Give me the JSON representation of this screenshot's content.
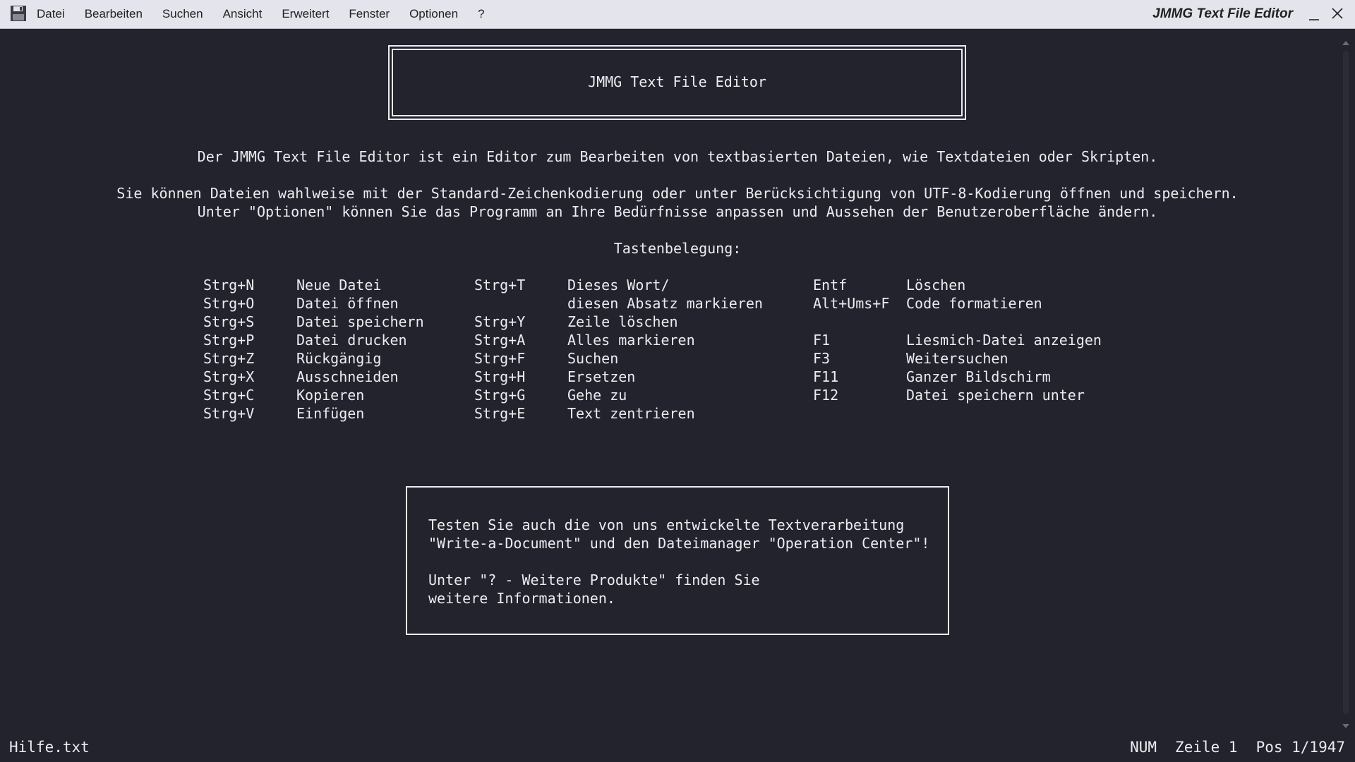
{
  "menubar": {
    "items": [
      "Datei",
      "Bearbeiten",
      "Suchen",
      "Ansicht",
      "Erweitert",
      "Fenster",
      "Optionen",
      "?"
    ],
    "app_title": "JMMG Text File Editor",
    "icons": {
      "app": "floppy-disk-icon",
      "minimize": "minimize-icon",
      "close": "close-icon"
    }
  },
  "document": {
    "title_box": "JMMG Text File Editor",
    "intro": "Der JMMG Text File Editor ist ein Editor zum Bearbeiten von textbasierten Dateien, wie Textdateien oder Skripten.",
    "encoding_line1": "Sie können Dateien wahlweise mit der Standard-Zeichenkodierung oder unter Berücksichtigung von UTF-8-Kodierung öffnen und speichern.",
    "encoding_line2": "Unter \"Optionen\" können Sie das Programm an Ihre Bedürfnisse anpassen und Aussehen der Benutzeroberfläche ändern.",
    "shortcuts_heading": "Tastenbelegung:",
    "shortcuts_col1": [
      {
        "key": "Strg+N",
        "action": "Neue Datei"
      },
      {
        "key": "Strg+O",
        "action": "Datei öffnen"
      },
      {
        "key": "Strg+S",
        "action": "Datei speichern"
      },
      {
        "key": "Strg+P",
        "action": "Datei drucken"
      },
      {
        "key": "Strg+Z",
        "action": "Rückgängig"
      },
      {
        "key": "Strg+X",
        "action": "Ausschneiden"
      },
      {
        "key": "Strg+C",
        "action": "Kopieren"
      },
      {
        "key": "Strg+V",
        "action": "Einfügen"
      }
    ],
    "shortcuts_col2": [
      {
        "key": "Strg+T",
        "action": "Dieses Wort/"
      },
      {
        "key": "",
        "action": "diesen Absatz markieren"
      },
      {
        "key": "Strg+Y",
        "action": "Zeile löschen"
      },
      {
        "key": "Strg+A",
        "action": "Alles markieren"
      },
      {
        "key": "Strg+F",
        "action": "Suchen"
      },
      {
        "key": "Strg+H",
        "action": "Ersetzen"
      },
      {
        "key": "Strg+G",
        "action": "Gehe zu"
      },
      {
        "key": "Strg+E",
        "action": "Text zentrieren"
      }
    ],
    "shortcuts_col3": [
      {
        "key": "Entf",
        "action": "Löschen"
      },
      {
        "key": "Alt+Ums+F",
        "action": "Code formatieren"
      },
      {
        "key": "",
        "action": ""
      },
      {
        "key": "F1",
        "action": "Liesmich-Datei anzeigen"
      },
      {
        "key": "F3",
        "action": "Weitersuchen"
      },
      {
        "key": "F11",
        "action": "Ganzer Bildschirm"
      },
      {
        "key": "F12",
        "action": "Datei speichern unter"
      },
      {
        "key": "",
        "action": ""
      }
    ],
    "note_lines": [
      "Testen Sie auch die von uns entwickelte Textverarbeitung",
      "\"Write-a-Document\" und den Dateimanager \"Operation Center\"!",
      "",
      "Unter \"? - Weitere Produkte\" finden Sie",
      "weitere Informationen."
    ]
  },
  "statusbar": {
    "file_name": "Hilfe.txt",
    "num": "NUM",
    "line": "Zeile 1",
    "pos": "Pos 1/1947"
  },
  "colors": {
    "editor_bg": "#22232c",
    "text": "#ececf0",
    "menubar_bg": "#e4e4ec"
  }
}
